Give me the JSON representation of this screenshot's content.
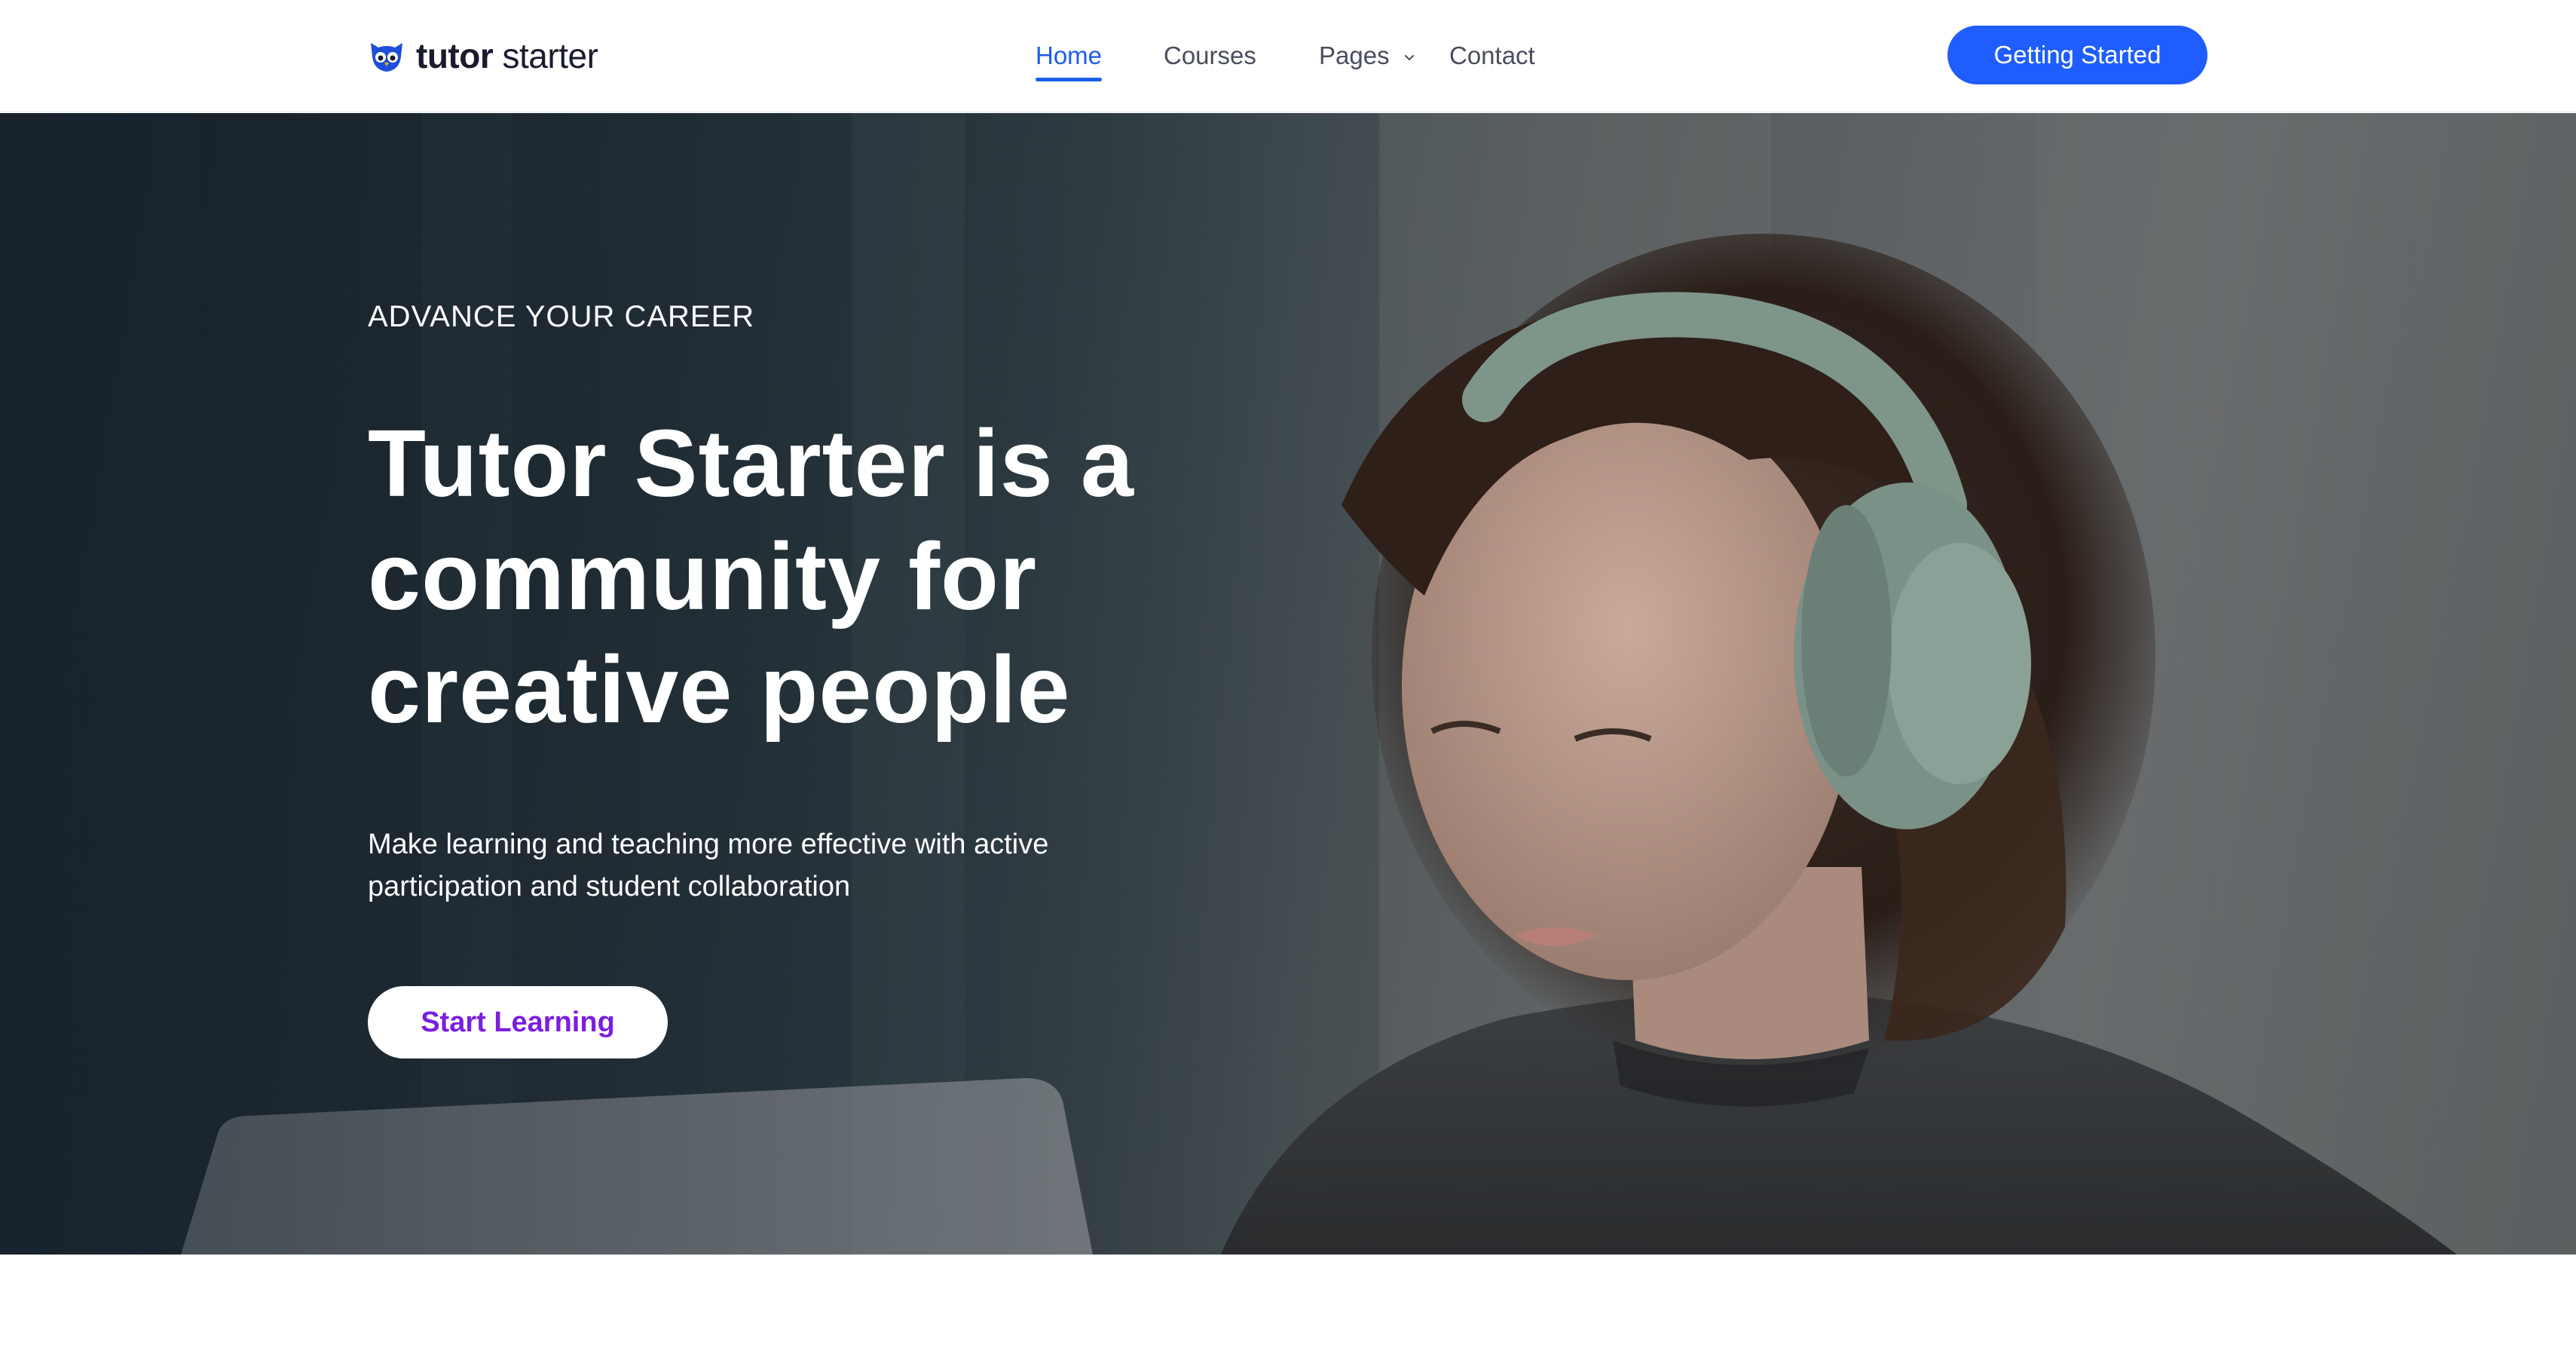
{
  "header": {
    "logo_bold": "tutor",
    "logo_light": "starter",
    "nav": [
      {
        "label": "Home",
        "active": true
      },
      {
        "label": "Courses",
        "active": false
      },
      {
        "label": "Pages",
        "active": false,
        "has_dropdown": true
      },
      {
        "label": "Contact",
        "active": false
      }
    ],
    "cta_label": "Getting Started"
  },
  "hero": {
    "eyebrow": "ADVANCE YOUR CAREER",
    "headline": "Tutor Starter is a community for creative people",
    "subtext": "Make learning and teaching more effective with active participation and student collaboration",
    "button_label": "Start Learning"
  },
  "colors": {
    "primary": "#1f5dff",
    "nav_active": "#1d5eea",
    "hero_button_text": "#7a1fe0",
    "headline": "#ffffff"
  },
  "icons": {
    "logo": "owl-logo-icon",
    "dropdown": "chevron-down-icon"
  }
}
